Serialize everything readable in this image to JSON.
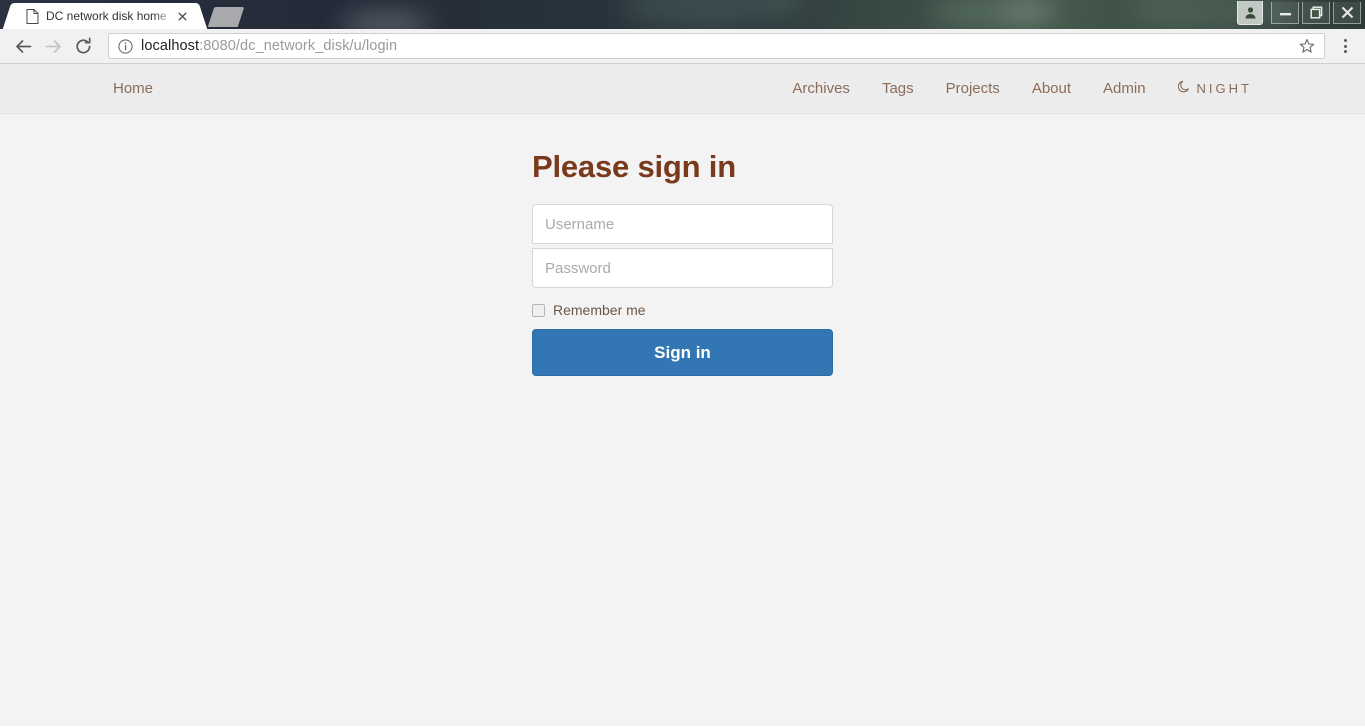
{
  "browser": {
    "tab": {
      "title": "DC network disk home",
      "favicon_icon": "page-icon",
      "close_icon": "close-icon"
    },
    "new_tab_icon": "new-tab-icon",
    "window_controls": {
      "profile_icon": "person-icon",
      "minimize_icon": "minimize-icon",
      "restore_icon": "restore-icon",
      "close_icon": "close-icon"
    },
    "toolbar": {
      "back_icon": "back-arrow-icon",
      "forward_icon": "forward-arrow-icon",
      "reload_icon": "reload-icon",
      "info_icon": "info-circle-icon",
      "url_host": "localhost",
      "url_path": ":8080/dc_network_disk/u/login",
      "star_icon": "star-icon",
      "menu_icon": "three-dots-menu-icon"
    }
  },
  "site_nav": {
    "brand": "Home",
    "links": [
      {
        "label": "Archives"
      },
      {
        "label": "Tags"
      },
      {
        "label": "Projects"
      },
      {
        "label": "About"
      },
      {
        "label": "Admin"
      }
    ],
    "night_toggle": {
      "icon": "moon-icon",
      "label": "NIGHT"
    }
  },
  "login": {
    "title": "Please sign in",
    "username_placeholder": "Username",
    "username_value": "",
    "password_placeholder": "Password",
    "password_value": "",
    "remember_label": "Remember me",
    "remember_checked": false,
    "submit_label": "Sign in"
  },
  "colors": {
    "accent_button": "#3277b3",
    "heading": "#79391b",
    "nav_link": "#8a6d5a",
    "nav_bg": "#ececec",
    "page_bg": "#f3f3f3"
  }
}
